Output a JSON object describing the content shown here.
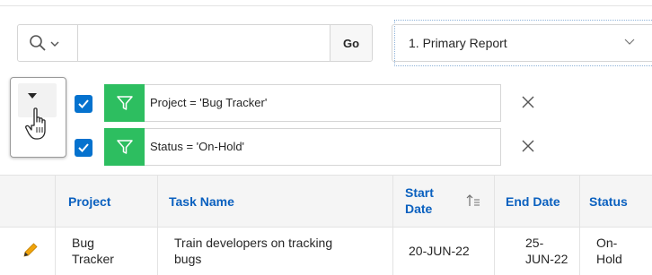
{
  "toolbar": {
    "search_placeholder": "",
    "go_label": "Go",
    "report_selected": "1. Primary Report"
  },
  "filters": [
    {
      "text": "Project = 'Bug Tracker'",
      "checked": true
    },
    {
      "text": "Status = 'On-Hold'",
      "checked": true
    }
  ],
  "table": {
    "headers": {
      "project": "Project",
      "task_name": "Task Name",
      "start_date_line1": "Start",
      "start_date_line2": "Date",
      "end_date": "End Date",
      "status": "Status"
    },
    "rows": [
      {
        "project_line1": "Bug",
        "project_line2": "Tracker",
        "task_line1": "Train developers on tracking",
        "task_line2": "bugs",
        "start_date": "20-JUN-22",
        "end_date_line1": "25-",
        "end_date_line2": "JUN-22",
        "status_line1": "On-",
        "status_line2": "Hold"
      }
    ]
  },
  "colors": {
    "accent_blue": "#0572ce",
    "header_link": "#0a60bf",
    "filter_green": "#2dbe60",
    "edit_pencil": "#f0a30a"
  }
}
